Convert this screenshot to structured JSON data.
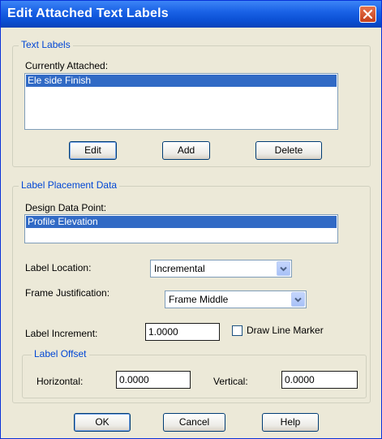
{
  "window": {
    "title": "Edit Attached Text Labels",
    "close_icon": "close-x-icon"
  },
  "text_labels": {
    "group_label": "Text Labels",
    "currently_attached_label": "Currently Attached:",
    "items": [
      "Ele side Finish"
    ],
    "edit_label": "Edit",
    "add_label": "Add",
    "delete_label": "Delete"
  },
  "placement": {
    "group_label": "Label Placement Data",
    "design_point_label": "Design Data Point:",
    "design_points": [
      "Profile Elevation"
    ],
    "location_label": "Label Location:",
    "location_value": "Incremental",
    "justification_label": "Frame Justification:",
    "justification_value": "Frame Middle",
    "increment_label": "Label Increment:",
    "increment_value": "1.0000",
    "draw_marker_label": "Draw Line Marker",
    "draw_marker_checked": false
  },
  "offset": {
    "group_label": "Label Offset",
    "horizontal_label": "Horizontal:",
    "horizontal_value": "0.0000",
    "vertical_label": "Vertical:",
    "vertical_value": "0.0000"
  },
  "footer": {
    "ok_label": "OK",
    "cancel_label": "Cancel",
    "help_label": "Help"
  },
  "colors": {
    "title_bar": "#0a4fd3",
    "selection": "#316ac5",
    "group_text": "#0046d5",
    "dialog_bg": "#ece9d8"
  }
}
